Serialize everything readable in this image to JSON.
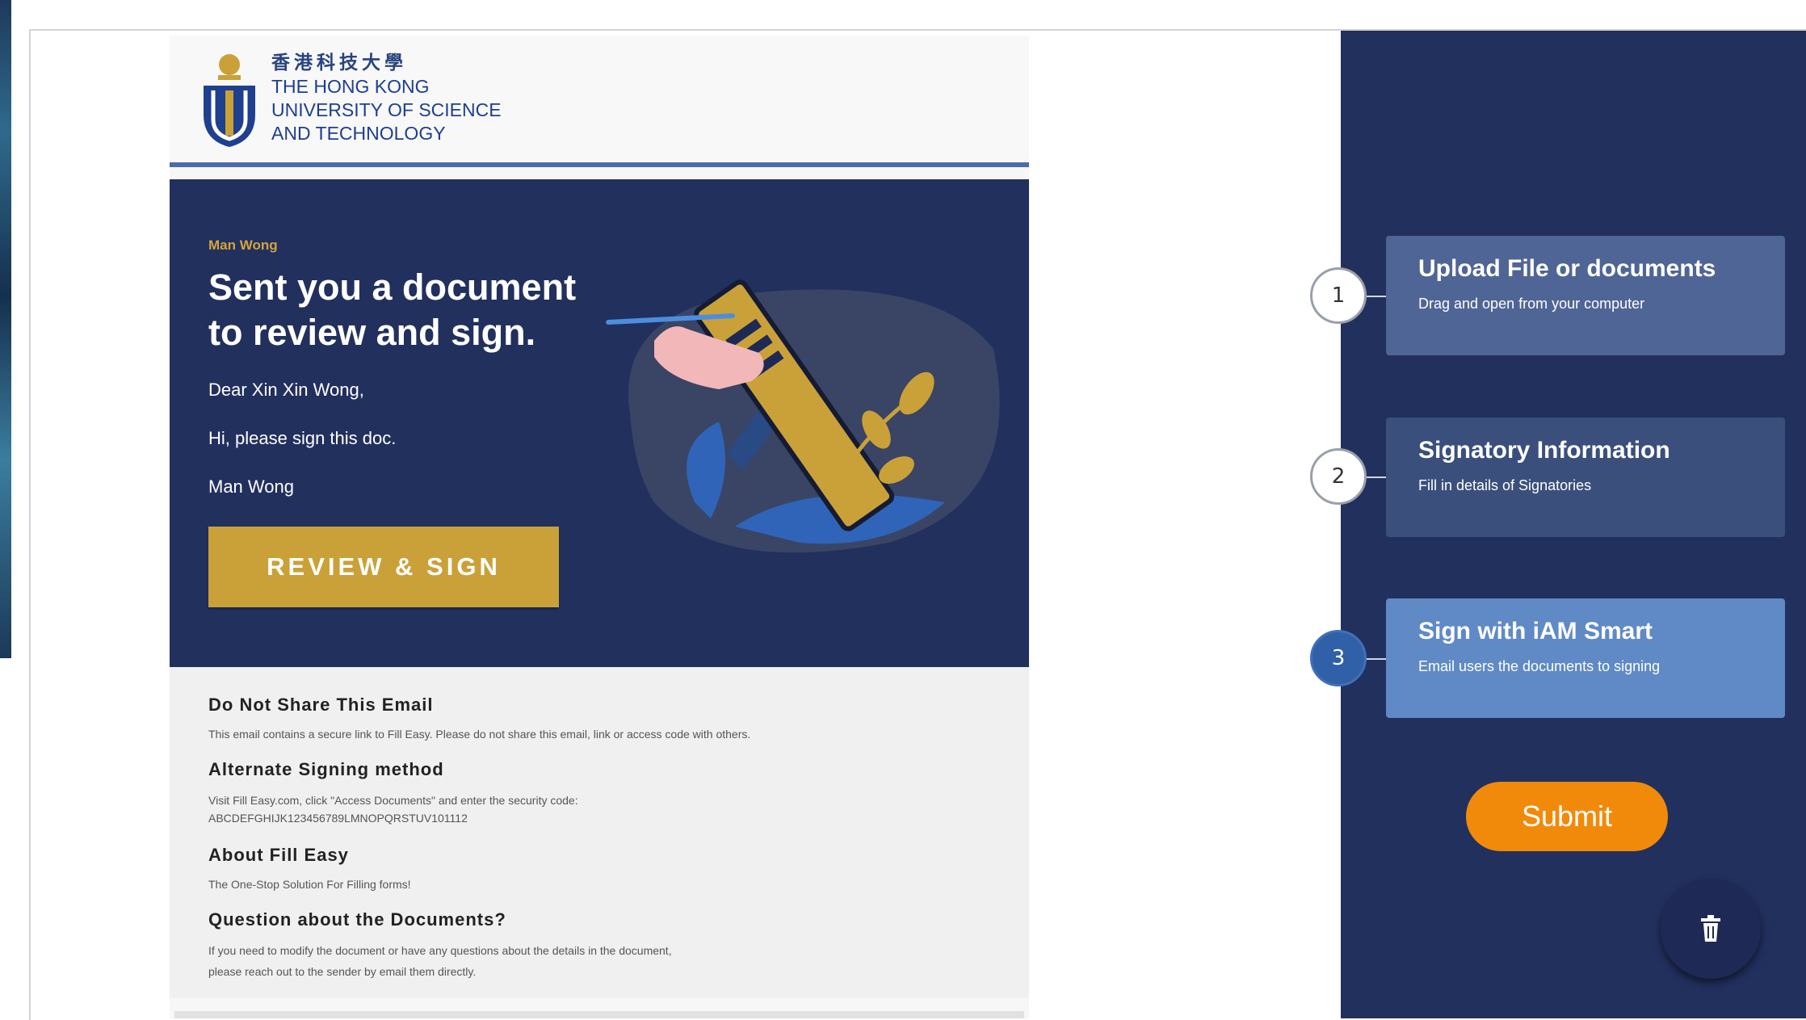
{
  "email": {
    "logo": {
      "chinese_name": "香港科技大學",
      "line1": "THE HONG KONG",
      "line2": "UNIVERSITY OF SCIENCE",
      "line3": "AND TECHNOLOGY"
    },
    "hero": {
      "sender": "Man Wong",
      "headline": "Sent you a document to review and sign.",
      "greeting": "Dear Xin Xin Wong,",
      "message": "Hi, please sign this doc.",
      "signature": "Man Wong",
      "cta_label": "REVIEW & SIGN"
    },
    "info": {
      "h1": "Do Not Share This Email",
      "p1": "This email contains a secure link to Fill Easy. Please do not share this email, link or access code with others.",
      "h2": "Alternate Signing method",
      "p2a": "Visit Fill Easy.com, click \"Access Documents\" and enter the security code:",
      "p2b": "ABCDEFGHIJK123456789LMNOPQRSTUV101112",
      "h3": "About Fill Easy",
      "p3": "The One-Stop Solution For Filling forms!",
      "h4": "Question about the Documents?",
      "p4a": "If you need to modify the document or have any questions about the details in the document,",
      "p4b": "please reach out to the sender by email them directly."
    }
  },
  "steps": [
    {
      "number": "1",
      "title": "Upload File or documents",
      "subtitle": "Drag and open from your computer",
      "state": "done"
    },
    {
      "number": "2",
      "title": "Signatory Information",
      "subtitle": "Fill in details of Signatories",
      "state": "done"
    },
    {
      "number": "3",
      "title": "Sign with iAM Smart",
      "subtitle": "Email users the documents to signing",
      "state": "active"
    }
  ],
  "submit_label": "Submit",
  "fab_icon": "trash-icon",
  "colors": {
    "navy": "#22305e",
    "gold": "#c9a138",
    "orange": "#f18a0a",
    "active_step": "#2f60a8"
  }
}
